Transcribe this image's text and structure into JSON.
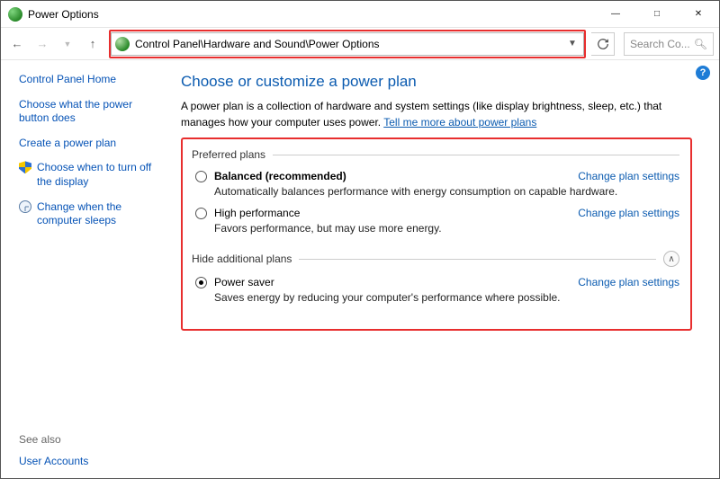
{
  "window": {
    "title": "Power Options"
  },
  "nav": {
    "address_path": "Control Panel\\Hardware and Sound\\Power Options",
    "search_placeholder": "Search Co..."
  },
  "sidebar": {
    "items": [
      {
        "label": "Control Panel Home",
        "icon": null
      },
      {
        "label": "Choose what the power button does",
        "icon": null
      },
      {
        "label": "Create a power plan",
        "icon": null
      },
      {
        "label": "Choose when to turn off the display",
        "icon": "shield"
      },
      {
        "label": "Change when the computer sleeps",
        "icon": "clock"
      }
    ],
    "see_also_label": "See also",
    "see_also_items": [
      {
        "label": "User Accounts"
      }
    ]
  },
  "main": {
    "title": "Choose or customize a power plan",
    "description": "A power plan is a collection of hardware and system settings (like display brightness, sleep, etc.) that manages how your computer uses power. ",
    "learn_more": "Tell me more about power plans",
    "groups": [
      {
        "label": "Preferred plans",
        "expandable": false,
        "plans": [
          {
            "name": "Balanced (recommended)",
            "bold": true,
            "selected": false,
            "desc": "Automatically balances performance with energy consumption on capable hardware.",
            "link": "Change plan settings"
          },
          {
            "name": "High performance",
            "bold": false,
            "selected": false,
            "desc": "Favors performance, but may use more energy.",
            "link": "Change plan settings"
          }
        ]
      },
      {
        "label": "Hide additional plans",
        "expandable": true,
        "plans": [
          {
            "name": "Power saver",
            "bold": false,
            "selected": true,
            "desc": "Saves energy by reducing your computer's performance where possible.",
            "link": "Change plan settings"
          }
        ]
      }
    ]
  },
  "help_tooltip": "?"
}
